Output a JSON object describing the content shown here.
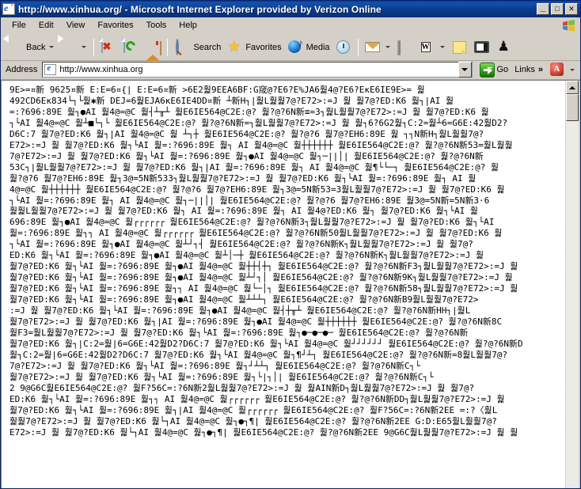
{
  "window": {
    "title": "http://www.xinhua.org/ - Microsoft Internet Explorer provided by Verizon Online",
    "icon": "ie-page-icon",
    "minimize_label": "_",
    "maximize_label": "□",
    "close_label": "✕"
  },
  "menu": {
    "items": [
      {
        "label": "File"
      },
      {
        "label": "Edit"
      },
      {
        "label": "View"
      },
      {
        "label": "Favorites"
      },
      {
        "label": "Tools"
      },
      {
        "label": "Help"
      }
    ],
    "logo": "windows-flag-icon"
  },
  "toolbar": {
    "back_label": "Back",
    "forward_label": "",
    "stop_label": "",
    "refresh_label": "",
    "home_label": "",
    "search_label": "Search",
    "favorites_label": "Favorites",
    "media_label": "Media",
    "history_label": "",
    "mail_label": "",
    "print_label": "",
    "edit_label": "W",
    "note_label": "",
    "messenger_label": "",
    "person_label": "☃"
  },
  "address": {
    "label": "Address",
    "url": "http://www.xinhua.org",
    "placeholder": "",
    "go_label": "Go",
    "links_label": "Links",
    "links_chevron": "»",
    "acrobat_label": "A"
  },
  "scrollbar": {
    "up_label": "",
    "down_label": "",
    "position_percent": 3
  },
  "content": {
    "encoding_note": "mojibake",
    "text": "9E>=¤新 9625¤新 E:E=6¤{| E:E=6¤新 >6E2훭9EEA6BF:G窚@?E6?E%JA6훭4@?E6?EĸE6IE9E>= 훭\n492CD6Eĸ834└┐└훭✱新 DEJ=6훭EJA6ĸE6IE4DD¤新 ┴新H┐|훭L훭훭7@?E72>:=J 훭 훭7@?ED:K6 훭┐|AI 훭\n=:?696:89E 훭┐●AI 훭4@=@C 훭┤┴╥┴ 훭E6IE564@C2E:@? 훭?@?6N新≡=3┐훭L훭훭7@?E72>:=J 훭 훭7@?ED:K6 훭\n┐└AI 훭4@=@C 훭┴■└┐└ 훭E6IE564@C2E:@? 훭?@?6N新=┐훭L훭훭7@?E72>:=J 훭 훭┐6?6G2훭┐C:2=훭┴6=G6E:42훭D2?\nD6C:7 훭7@?ED:K6 훭┐|AI 훭4@=@C 훭 ┴┐┼ 훭E6IE564@C2E:@? 훭?@?6 훭7@?EH6:89E 훭 ┐┐N新H┐훭L훭훭7@?\nE72>:=J 훭 훭7@?ED:K6 훭┐└AI 훭=:?696:89E 훭┐ AI 훭4@=@C 훭┼┼┼┼┼┼ 훭E6IE564@C2E:@? 훭?@?6N新53=훭L훭훭\n7@?E72>:=J 훭 훭7@?ED:K6 훭┐└AI 훭=:?696:89E 훭┐●AI 훭4@=@C 훭┐─||│| 훭E6IE564@C2E:@? 훭?@?6N新\n53C┐|훭L훭훭7@?E72>:=J 훭 훭7@?ED:K6 훭┐|AI 훭=:?696:89E 훭┐ AI 훭4@=@C 훭¶└└─┐ 훭E6IE564@C2E:@? 훭\n훭?@?6 훭7@?EH6:89E 훭┐3@=5N新533┐훭L훭훭7@?E72>:=J 훭 훭7@?ED:K6 훭┐└AI 훭=:?696:89E 훭┐ AI 훭\n4@=@C 훭┼┼┼┼┼┼ 훭E6IE564@C2E:@? 훭?@?6 훭7@?EH6:89E 훭┐3@=5N新53=3훭L훭훭7@?E72>:=J 훭 훭7@?ED:K6 훭\n┐└AI 훭=:?696:89E 훭┐ AI 훭4@=@C 훭┐─||│| 훭E6IE564@C2E:@? 훭?@?6 훭7@?EH6:89E 훭3@=5N新=5N新3·6\n훭훭L훭훭7@?E72>:=J 훭 훭7@?ED:K6 훭┐ AI 훭=:?696:89E 훭┐ AI 훭4@?ED:K6 훭┐ 훭7@?ED:K6 훭┐└AI 훭\n696:89E 훭┐●AI 훭4@=@C 훭┌┌┌┌┌┌ 훭E6IE564@C2E:@? 훭?@?6N新3┐훭L훭훭7@?E72>:=J 훭 훭7@?ED:K6 훭┐└AI\n훭=:?696:89E 훭┐┐ AI 훭4@=@C 훭┌┌┌┌┌┌ 훭E6IE564@C2E:@? 훭?@?6N新50훭L훭훭7@?E72>:=J 훭 훭7@?ED:K6 훭\n┐└AI 훭=:?696:89E 훭┐●AI 훭4@=@C 훭┴┘┐┤ 훭E6IE564@C2E:@? 훭?@?6N新K┐훭L훭훭7@?E72>:=J 훭 훭7@?\nED:K6 훭┐└AI 훭=:?696:89E 훭┐●AI 훭4@=@C 훭┴│─┼ 훭E6IE564@C2E:@? 훭?@?6N新K┐훭L훭훭7@?E72>:=J 훭\n훭7@?ED:K6 훭┐└AI 훭=:?696:89E 훭┐●AI 훭4@=@C 훭┼┼┤┼┐ 훭E6IE564@C2E:@? 훭?@?6N新F3┐훭L훭훭7@?E72>:=J 훭\n훭7@?ED:K6 훭┐└AI 훭=:?696:89E 훭┐●AI 훭4@=@C 훭┴┘┐│ 훭E6IE564@C2E:@? 훭?@?6N新9K┐훭L훭훭7@?E72>:=J 훭\n훭7@?ED:K6 훭┐└AI 훭=:?696:89E 훭┐┐ AI 훭4@=@C 훭└─│┐ 훭E6IE564@C2E:@? 훭?@?6N新58┐훭L훭훭7@?E72>:=J 훭\n훭7@?ED:K6 훭┐└AI 훭=:?696:89E 훭┐●AI 훭4@=@C 훭┴┴┴┐ 훭E6IE564@C2E:@? 훭?@?6N新B9훭L훭훭7@?E72>\n:=J 훭 훭7@?ED:K6 훭┐└AI 훭=:?696:89E 훭┐●AI 훭4@=@C 훭┤┼╥┴ 훭E6IE564@C2E:@? 훭?@?6N新HH┐|훭L\n훭7@?E72>:=J 훭 훭7@?ED:K6 훭┐|AI 훭=:?696:89E 훭┐●AI 훭4@=@C 훭┼┼┼┼┼┼ 훭E6IE564@C2E:@? 훭?@?6N新8C\n훭F3=훭L훭훭7@?E72>:=J 훭 훭7@?ED:K6 훭┐└AI 훭=:?696:89E 훭┐●─●─●─ 훭E6IE564@C2E:@? 훭?@?6N新\n훭7@?ED:K6 훭┐|C:2=훭|6=G6E:42훭D2?D6C:7 훭7@?ED:K6 훭┐└AI 훭4@=@C 훭┘┘┘┘┘┘ 훭E6IE564@C2E:@? 훭?@?6N新D\n훭┐C:2=훭|6=G6E:42훭D2?D6C:7 훭7@?ED:K6 훭┐└AI 훭4@=@C 훭┐¶┘┴┐ 훭E6IE564@C2E:@? 훭?@?6N新=8훭L훭훭7@?\n7@?E72>:=J 훭 훭7@?ED:K6 훭┐└AI 훭=:?696:89E 훭┐┘┴┴┐ 훭E6IE564@C2E:@? 훭?@?6N新C┐└\n훭7@?E72>:=J 훭 훭7@?ED:K6 훭┐└AI 훭=:?696:89E 훭┐└|┐│| 훭E6IE564@C2E:@? 훭?@?6N新C┐└\n2 9@G6C훭E6IE564@C2E:@? 훭F?56C=:?6N新2훭L훭훭7@?E72>:=J 훭 훭AIN新D┐훭L훭훭7@?E72>:=J 훭 훭7@?\nED:K6 훭┐└AI 훭=:?696:89E 훭┐┐ AI 훭4@=@C 훭┌┌┌┌┌┌ 훭E6IE564@C2E:@? 훭?@?6N新DD┐훭L훭훭7@?E72>:=J 훭\n훭7@?ED:K6 훭┐└AI 훭=:?696:89E 훭┐|AI 훭4@=@C 훭┌┌┌┌┌┌ 훭E6IE564@C2E:@? 훭F?56C=:?6N新2EE =:?〈훭L\n훭훭7@?E72>:=J 훭 훭7@?ED:K6 훭└┐AI 훭4@=@C 훭┐●┐¶| 훭E6IE564@C2E:@? 훭?@?6N新2EE G:D:E65훭L훭훭7@?\nE72>:=J 훭 훭7@?ED:K6 훭└┐AI 훭4@=@C 훭┐●┐¶| 훭E6IE564@C2E:@? 훭?@?6N新2EE 9@G6C훭L훭훭7@?E72>:=J 훭 훭"
  }
}
